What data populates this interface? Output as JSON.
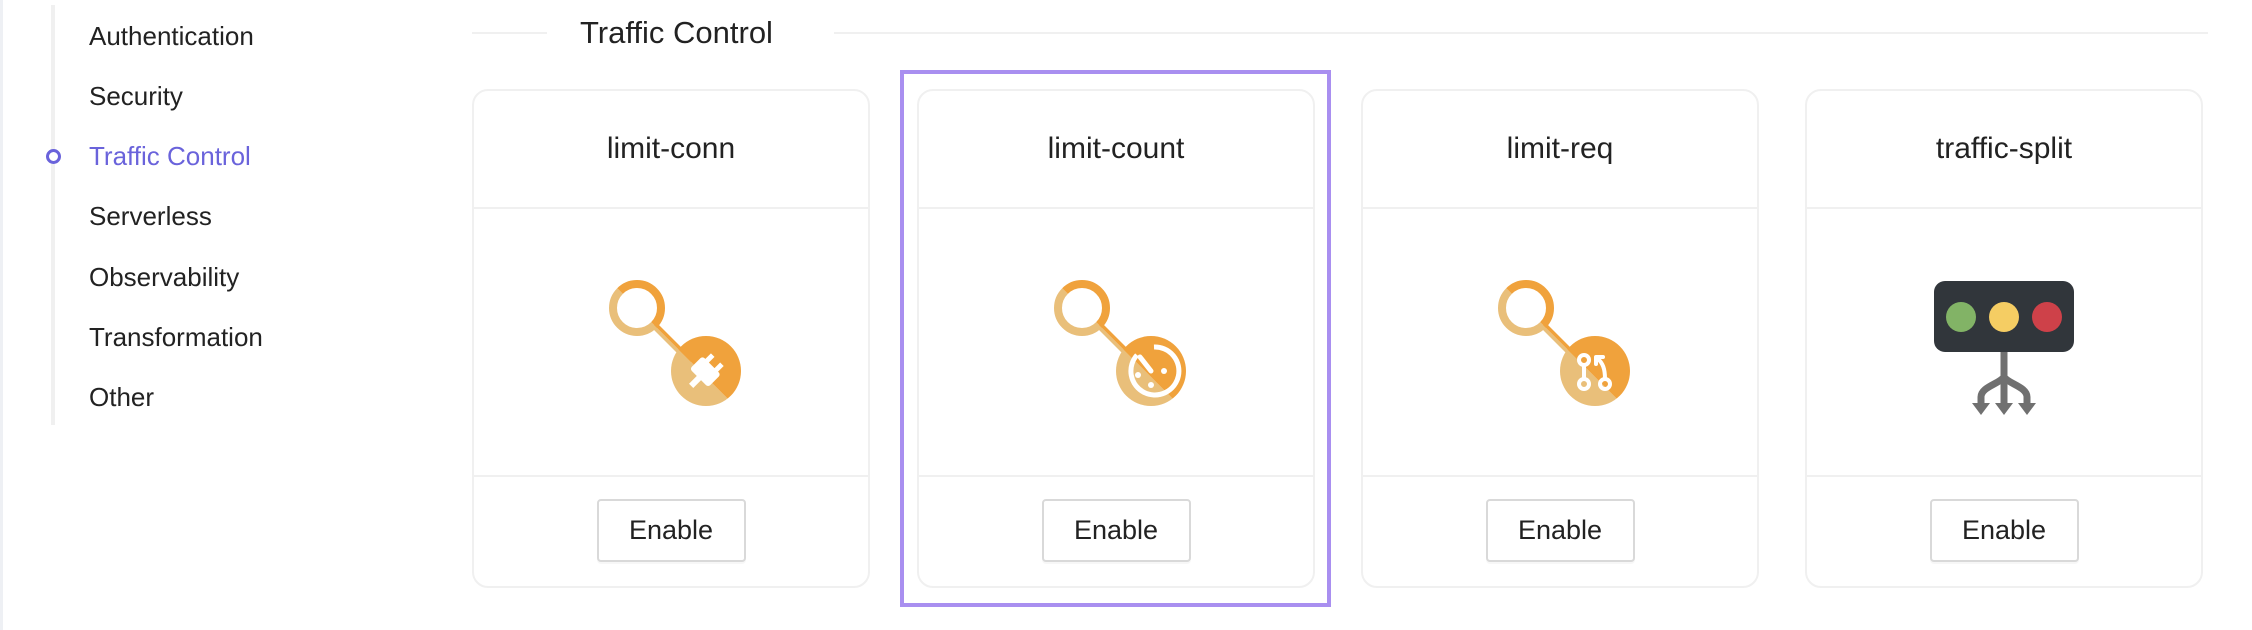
{
  "sidebar": {
    "items": [
      {
        "label": "Authentication",
        "active": false
      },
      {
        "label": "Security",
        "active": false
      },
      {
        "label": "Traffic Control",
        "active": true
      },
      {
        "label": "Serverless",
        "active": false
      },
      {
        "label": "Observability",
        "active": false
      },
      {
        "label": "Transformation",
        "active": false
      },
      {
        "label": "Other",
        "active": false
      }
    ],
    "active_color": "#6a63db"
  },
  "section": {
    "title": "Traffic Control"
  },
  "plugins": [
    {
      "name": "limit-conn",
      "icon": "plug-connection-icon",
      "button_label": "Enable",
      "highlighted": false
    },
    {
      "name": "limit-count",
      "icon": "count-timer-icon",
      "button_label": "Enable",
      "highlighted": true
    },
    {
      "name": "limit-req",
      "icon": "request-branch-icon",
      "button_label": "Enable",
      "highlighted": false
    },
    {
      "name": "traffic-split",
      "icon": "traffic-light-split-icon",
      "button_label": "Enable",
      "highlighted": false
    }
  ],
  "colors": {
    "icon_orange_dark": "#f0a23c",
    "icon_orange_light": "#e9bf7a",
    "traffic_light_body": "#31363b",
    "traffic_light_green": "#82b366",
    "traffic_light_yellow": "#f5cd63",
    "traffic_light_red": "#ce4149",
    "split_arrows": "#707070",
    "highlight_border": "#a98ff0"
  }
}
